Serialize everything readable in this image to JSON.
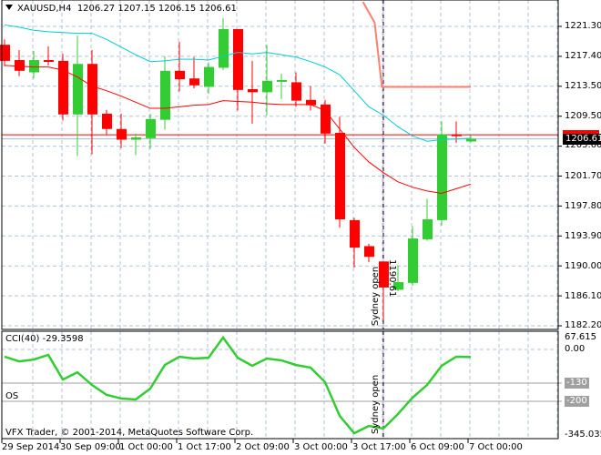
{
  "header": {
    "symbol": "XAUUSD,H4",
    "open": "1206.27",
    "high": "1207.15",
    "low": "1206.15",
    "close": "1206.61"
  },
  "price_axis": {
    "labels": [
      "1221.30",
      "1217.40",
      "1213.50",
      "1209.50",
      "1205.60",
      "1201.70",
      "1197.80",
      "1193.90",
      "1190.00",
      "1186.10",
      "1182.20"
    ],
    "current_price": "1206.61"
  },
  "cci_panel": {
    "title": "CCI(40) -29.3598",
    "os_label": "OS",
    "axis_labels": {
      "max": "67.615",
      "zero": "0.00",
      "level1": "-130",
      "level2": "-200",
      "min": "-345.0355"
    },
    "copyright": "VFX Trader, © 2001-2014, MetaQuotes Software Corp."
  },
  "time_axis": [
    "29 Sep 2014",
    "30 Sep 09:00",
    "1 Oct 00:00",
    "1 Oct 17:00",
    "2 Oct 09:00",
    "3 Oct 00:00",
    "3 Oct 17:00",
    "6 Oct 09:00",
    "7 Oct 00:00"
  ],
  "events": {
    "sydney_open": "Sydney open",
    "price_marker": "1190.61"
  },
  "colors": {
    "bull": "#32cd32",
    "bear": "#ff0000",
    "ma_fast": "#ff0000",
    "ma_slow": "#00ced1",
    "stop_line": "#fa8072",
    "cci": "#32cd32",
    "grid": "#b0c4de"
  },
  "chart_data": {
    "type": "candlestick",
    "title": "XAUUSD,H4",
    "ylim": [
      1182.2,
      1221.3
    ],
    "ohlc": [
      [
        1218.9,
        1219.6,
        1216.1,
        1216.8
      ],
      [
        1216.9,
        1218.2,
        1214.8,
        1215.5
      ],
      [
        1215.3,
        1218.1,
        1214.5,
        1216.9
      ],
      [
        1216.9,
        1218.7,
        1216.2,
        1216.7
      ],
      [
        1216.8,
        1217.7,
        1209.0,
        1209.8
      ],
      [
        1209.8,
        1220.1,
        1204.4,
        1216.4
      ],
      [
        1216.4,
        1218.2,
        1204.6,
        1209.8
      ],
      [
        1209.9,
        1210.4,
        1207.2,
        1207.9
      ],
      [
        1207.9,
        1209.9,
        1205.4,
        1206.5
      ],
      [
        1206.5,
        1207.3,
        1204.5,
        1206.8
      ],
      [
        1206.7,
        1209.9,
        1205.3,
        1209.2
      ],
      [
        1209.1,
        1217.4,
        1207.8,
        1215.5
      ],
      [
        1215.5,
        1219.3,
        1212.8,
        1214.4
      ],
      [
        1214.5,
        1217.3,
        1213.2,
        1213.6
      ],
      [
        1213.4,
        1216.6,
        1212.5,
        1216.0
      ],
      [
        1215.9,
        1222.4,
        1215.6,
        1220.95
      ],
      [
        1220.95,
        1220.95,
        1210.3,
        1213.0
      ],
      [
        1213.1,
        1216.8,
        1208.6,
        1212.7
      ],
      [
        1212.7,
        1218.9,
        1209.7,
        1214.2
      ],
      [
        1214.2,
        1215.1,
        1211.8,
        1214.3
      ],
      [
        1214.0,
        1215.3,
        1210.8,
        1211.6
      ],
      [
        1211.7,
        1213.5,
        1210.3,
        1211.0
      ],
      [
        1211.1,
        1211.7,
        1206.0,
        1207.3
      ],
      [
        1207.4,
        1209.5,
        1195.0,
        1196.1
      ],
      [
        1196.0,
        1196.3,
        1189.8,
        1192.4
      ],
      [
        1192.6,
        1192.9,
        1190.5,
        1191.2
      ],
      [
        1190.6,
        1190.6,
        1182.9,
        1187.2
      ],
      [
        1186.9,
        1190.1,
        1186.7,
        1187.9
      ],
      [
        1187.8,
        1195.2,
        1187.4,
        1193.6
      ],
      [
        1193.5,
        1198.8,
        1193.3,
        1196.1
      ],
      [
        1196.0,
        1208.9,
        1195.3,
        1207.2
      ],
      [
        1207.2,
        1208.9,
        1206.1,
        1207.1
      ],
      [
        1206.27,
        1207.15,
        1206.15,
        1206.61
      ]
    ],
    "ma_slow": [
      1221.5,
      1221.2,
      1220.8,
      1220.6,
      1220.5,
      1220.4,
      1220.4,
      1219.6,
      1218.6,
      1217.6,
      1216.7,
      1216.8,
      1217.0,
      1217.0,
      1216.9,
      1217.4,
      1217.9,
      1217.7,
      1217.9,
      1217.6,
      1217.3,
      1216.7,
      1216.0,
      1215.0,
      1212.9,
      1210.8,
      1209.7,
      1208.2,
      1207.0,
      1206.3,
      1206.5,
      1206.6,
      1206.7
    ],
    "ma_fast": [
      1216.2,
      1216.1,
      1216.0,
      1216.0,
      1215.6,
      1214.7,
      1213.5,
      1212.9,
      1212.2,
      1211.4,
      1210.6,
      1210.6,
      1210.8,
      1211.0,
      1211.1,
      1211.6,
      1211.5,
      1211.4,
      1211.2,
      1211.1,
      1211.1,
      1211.1,
      1210.3,
      1207.9,
      1205.5,
      1203.6,
      1202.2,
      1201.0,
      1200.3,
      1199.8,
      1199.5,
      1200.1,
      1200.7
    ],
    "stop_line": {
      "start_index": 24.6,
      "values": [
        [
          24.6,
          1224.5
        ],
        [
          25.4,
          1221.8
        ],
        [
          25.9,
          1213.4
        ],
        [
          32,
          1213.4
        ]
      ]
    },
    "bid": 1206.61,
    "ask": 1207.15,
    "cci": {
      "ylim": [
        -345.0355,
        67.615
      ],
      "levels": [
        -130,
        -200
      ],
      "values": [
        -28,
        -46,
        -39,
        -21,
        -116,
        -88,
        -137,
        -175,
        -189,
        -193,
        -151,
        -60,
        -28,
        -35,
        -32,
        46,
        -32,
        -63,
        -35,
        -42,
        -60,
        -70,
        -126,
        -256,
        -323,
        -295,
        -305,
        -249,
        -186,
        -137,
        -63,
        -28,
        -29.3598
      ]
    },
    "event_index": 26
  }
}
